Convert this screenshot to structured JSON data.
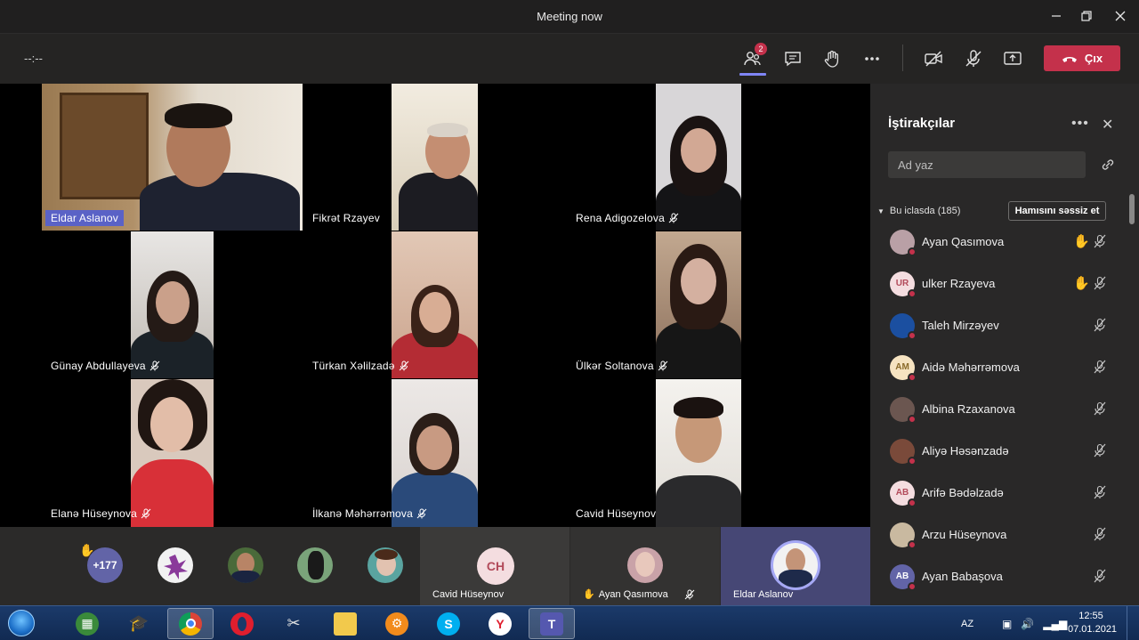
{
  "window": {
    "title": "Meeting now",
    "minimize_icon": "minimize-icon",
    "maximize_icon": "restore-icon",
    "close_icon": "close-icon"
  },
  "toolbar": {
    "timer": "--:--",
    "participants_badge": "2",
    "leave_label": "Çıx",
    "leave_color": "#c4314b",
    "accent": "#7f85f5",
    "icons": [
      "participants-icon",
      "chat-icon",
      "raise-hand-icon",
      "more-icon",
      "camera-off-icon",
      "mic-off-icon",
      "share-screen-icon",
      "hang-up-icon"
    ]
  },
  "videos": [
    {
      "name": "Eldar  Aslanov",
      "muted": false,
      "active_speaker": true
    },
    {
      "name": "Fikrət Rzayev",
      "muted": false
    },
    {
      "name": "Rena Adigozelova",
      "muted": true
    },
    {
      "name": "Günay Abdullayeva",
      "muted": true
    },
    {
      "name": "Türkan Xəlilzadə",
      "muted": true
    },
    {
      "name": "Ülkər Soltanova",
      "muted": true
    },
    {
      "name": "Elanə Hüseynova",
      "muted": true
    },
    {
      "name": "İlkanə Məhərrəmova",
      "muted": true
    },
    {
      "name": "Cavid Hüseynov",
      "muted": false
    }
  ],
  "strip": {
    "overflow_count": "+177",
    "slots": [
      {
        "name": "Cavid Hüseynov",
        "initials": "CH"
      },
      {
        "name": "Ayan Qasımova",
        "hand_raised": true,
        "muted": true
      },
      {
        "name": "Eldar Aslanov"
      }
    ]
  },
  "panel": {
    "title": "İştirakçılar",
    "search_placeholder": "Ad yaz",
    "section_label": "Bu iclasda (185)",
    "mute_all_label": "Hamısını səssiz et",
    "participants": [
      {
        "name": "Ayan Qasımova",
        "initials": "",
        "avatar_color": "#b9a0a6",
        "hand_raised": true
      },
      {
        "name": "ulker Rzayeva",
        "initials": "UR",
        "avatar_color": "#f4dde0",
        "initials_color": "#b24a5a",
        "hand_raised": true
      },
      {
        "name": "Taleh Mirzəyev",
        "initials": "",
        "avatar_color": "#1b4fa0",
        "hand_raised": false
      },
      {
        "name": "Aidə Məhərrəmova",
        "initials": "AM",
        "avatar_color": "#f6e3c1",
        "initials_color": "#8a6a2a",
        "hand_raised": false
      },
      {
        "name": "Albina Rzaxanova",
        "initials": "",
        "avatar_color": "#6b5650",
        "hand_raised": false
      },
      {
        "name": "Aliyə Həsənzadə",
        "initials": "",
        "avatar_color": "#7a4a3a",
        "hand_raised": false
      },
      {
        "name": "Arifə Bədəlzadə",
        "initials": "AB",
        "avatar_color": "#f4dde0",
        "initials_color": "#b24a5a",
        "hand_raised": false
      },
      {
        "name": "Arzu Hüseynova",
        "initials": "",
        "avatar_color": "#c9b9a0",
        "hand_raised": false
      },
      {
        "name": "Ayan Babaşova",
        "initials": "AB",
        "avatar_color": "#6264a7",
        "initials_color": "#ffffff",
        "hand_raised": false
      }
    ]
  },
  "taskbar": {
    "apps": [
      "explorer-app",
      "green-app",
      "school-app",
      "chrome-app",
      "opera-app",
      "snipping-app",
      "folder-app",
      "settings-app",
      "skype-app",
      "yandex-app",
      "teams-app"
    ],
    "language": "AZ",
    "time": "12:55",
    "date": "07.01.2021"
  }
}
